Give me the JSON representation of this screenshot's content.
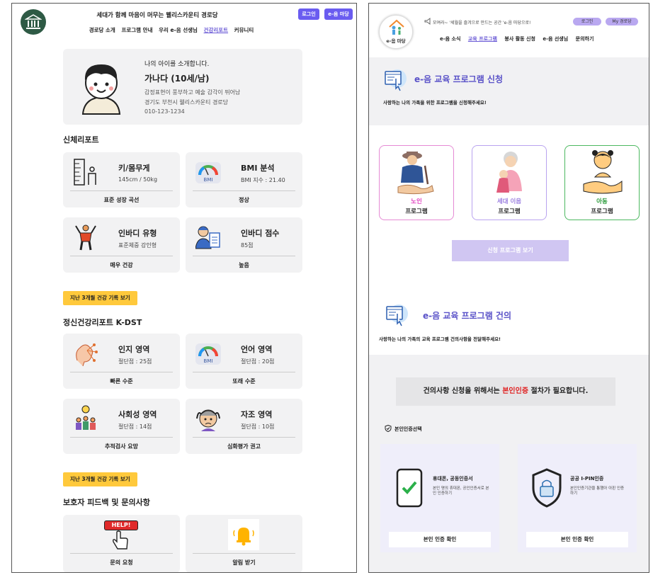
{
  "left": {
    "header": {
      "title": "세대가 함께 마음이 머무는 웰리스카운티 경로당",
      "login_label": "로그인",
      "e_madang_label": "e-음 마당",
      "menu": [
        "경로당 소개",
        "프로그램 안내",
        "우리 e-음 선생님",
        "건강리포트",
        "커뮤니티"
      ],
      "active_menu": "건강리포트"
    },
    "profile": {
      "intro": "나의 아이를 소개합니다.",
      "name": "가나다 (10세/남)",
      "line1": "감정표현이 풍부하고 예술 감각이 뛰어남",
      "line2": "경기도 부천시 웰리스카운티 경로당",
      "phone": "010-123-1234"
    },
    "body_report": {
      "title": "신체리포트",
      "cards": [
        {
          "title": "키/몸무게",
          "sub": "145cm / 50kg",
          "foot": "표준 성장 곡선",
          "icon": "ruler-height-icon"
        },
        {
          "title": "BMI 분석",
          "sub": "BMI 지수 : 21.40",
          "foot": "정상",
          "icon": "bmi-gauge-icon"
        },
        {
          "title": "인바디 유형",
          "sub": "표준체중 강인형",
          "foot": "매우 건강",
          "icon": "exercise-person-icon"
        },
        {
          "title": "인바디 점수",
          "sub": "85점",
          "foot": "높음",
          "icon": "doctor-report-icon"
        }
      ],
      "history_label": "지난 3개월 건강 기록 보기"
    },
    "mental_report": {
      "title": "정신건강리포트 K-DST",
      "cards": [
        {
          "title": "인지 영역",
          "sub": "절단점 : 25점",
          "foot": "빠른 수준",
          "icon": "brain-network-icon"
        },
        {
          "title": "언어 영역",
          "sub": "절단점 : 20점",
          "foot": "또래 수준",
          "icon": "bmi-gauge-icon"
        },
        {
          "title": "사회성 영역",
          "sub": "절단점 : 14점",
          "foot": "추적검사 요망",
          "icon": "social-group-icon"
        },
        {
          "title": "자조 영역",
          "sub": "절단점 : 10점",
          "foot": "심화평가 권고",
          "icon": "stressed-person-icon"
        }
      ],
      "history_label": "지난 3개월 건강 기록 보기"
    },
    "feedback": {
      "title": "보호자 피드백 및 문의사항",
      "help_text": "HELP!",
      "cards": [
        {
          "foot": "문의 요청",
          "icon": "help-hand-icon"
        },
        {
          "foot": "알림 받기",
          "icon": "bell-icon"
        }
      ]
    }
  },
  "right": {
    "header": {
      "logo_text": "e-음 마당",
      "note": "모여라~ '세월을 즐겨으로 만드는 공간 'e-음 마당으로!",
      "login_label": "로그인",
      "my_label": "My 경로당",
      "menu": [
        "e-음 소식",
        "교육 프로그램",
        "봉사 활동 신청",
        "e-음 선생님",
        "문의하기"
      ],
      "active_menu": "교육 프로그램"
    },
    "apply": {
      "title": "e-음 교육 프로그램 신청",
      "subtitle": "사랑하는 나의 가족을 위한 프로그램을 신청해주세요!",
      "programs": [
        {
          "line1": "노인",
          "line2": "프로그램",
          "color": "#e040c0"
        },
        {
          "line1": "세대 이음",
          "line2": "프로그램",
          "color": "#9a7ee0"
        },
        {
          "line1": "아동",
          "line2": "프로그램",
          "color": "#2a9a3a"
        }
      ],
      "view_button": "신청 프로그램 보기"
    },
    "suggest": {
      "title": "e-음 교육 프로그램 건의",
      "subtitle": "사랑하는 나의 가족의 교육 프로그램 건의사항을 전달해주세요!",
      "notice_before": "건의사항 신청을 위해서는 ",
      "notice_highlight": "본인인증",
      "notice_after": " 절차가 필요합니다.",
      "auth_select": "본인인증선택",
      "methods": [
        {
          "title": "휴대폰, 공동인증서",
          "desc": "본인 명의 휴대폰, 공인인증서로 본인 인증하기",
          "button": "본인 인증 확인",
          "icon": "phone-check-icon"
        },
        {
          "title": "공공 I-PIN인증",
          "desc": "본인인증기관을 통행아 아핀 인증 하기",
          "button": "본인 인증 확인",
          "icon": "shield-lock-icon"
        }
      ]
    }
  }
}
